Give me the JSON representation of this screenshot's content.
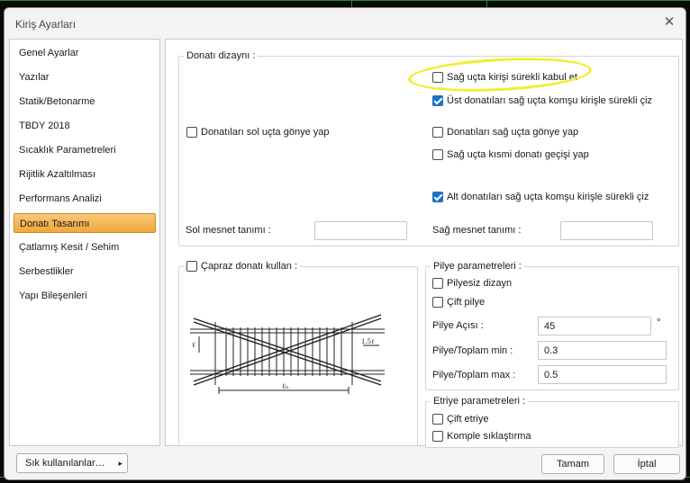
{
  "window": {
    "title": "Kiriş Ayarları",
    "close_glyph": "✕"
  },
  "sidebar": {
    "items": [
      {
        "label": "Genel Ayarlar",
        "active": false
      },
      {
        "label": "Yazılar",
        "active": false
      },
      {
        "label": "Statik/Betonarme",
        "active": false
      },
      {
        "label": "TBDY 2018",
        "active": false
      },
      {
        "label": "Sıcaklık Parametreleri",
        "active": false
      },
      {
        "label": "Rijitlik Azaltılması",
        "active": false
      },
      {
        "label": "Performans Analizi",
        "active": false
      },
      {
        "label": "Donatı Tasarımı",
        "active": true
      },
      {
        "label": "Çatlamış Kesit / Sehim",
        "active": false
      },
      {
        "label": "Serbestlikler",
        "active": false
      },
      {
        "label": "Yapı Bileşenleri",
        "active": false
      }
    ]
  },
  "donati": {
    "title": "Donatı dizaynı :",
    "sag_surekli": {
      "label": "Sağ uçta kirişi sürekli kabul et",
      "checked": false
    },
    "ust_surekli": {
      "label": "Üst donatıları sağ uçta komşu kirişle sürekli çiz",
      "checked": true
    },
    "sol_gonye": {
      "label": "Donatıları sol uçta gönye yap",
      "checked": false
    },
    "sag_gonye": {
      "label": "Donatıları sağ uçta gönye yap",
      "checked": false
    },
    "sag_kismi": {
      "label": "Sağ uçta kısmi donatı geçişi yap",
      "checked": false
    },
    "alt_surekli": {
      "label": "Alt donatıları sağ uçta komşu kirişle sürekli çiz",
      "checked": true
    },
    "sol_mesnet_label": "Sol mesnet tanımı :",
    "sol_mesnet_value": "",
    "sag_mesnet_label": "Sağ mesnet tanımı :",
    "sag_mesnet_value": ""
  },
  "capraz": {
    "label": "Çapraz donatı kullan :",
    "checked": false,
    "diagram_labels": {
      "left": "ℓ",
      "right": "1.5ℓ",
      "bottom": "ℓₙ"
    }
  },
  "pilye": {
    "title": "Pilye parametreleri :",
    "pilyesiz": {
      "label": "Pilyesiz dizayn",
      "checked": false
    },
    "cift": {
      "label": "Çift pilye",
      "checked": false
    },
    "aci_label": "Pilye Açısı :",
    "aci_value": "45",
    "aci_unit": "°",
    "min_label": "Pilye/Toplam min :",
    "min_value": "0.3",
    "max_label": "Pilye/Toplam max :",
    "max_value": "0.5"
  },
  "etriye": {
    "title": "Etriye parametreleri :",
    "cift": {
      "label": "Çift etriye",
      "checked": false
    },
    "komple": {
      "label": "Komple sıklaştırma",
      "checked": false
    }
  },
  "footer": {
    "favorites_label": "Sık kullanılanlar…",
    "favorites_arrow": "▸",
    "ok_label": "Tamam",
    "cancel_label": "İptal"
  }
}
